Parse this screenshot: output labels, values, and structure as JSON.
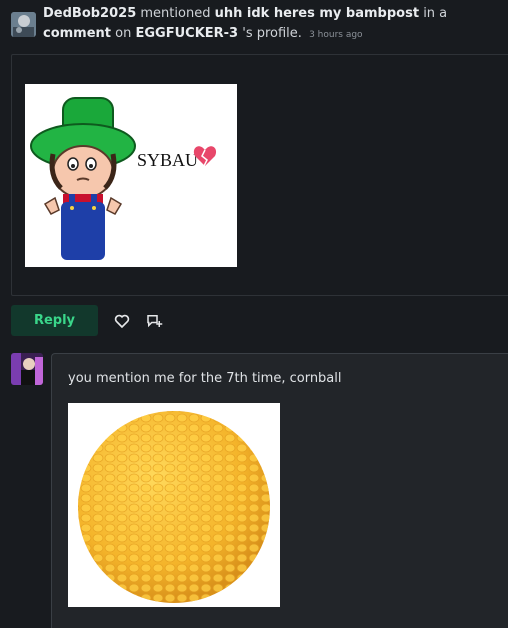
{
  "notification": {
    "actor": "DedBob2025",
    "verb": "mentioned",
    "post_title": "uhh idk heres my bambpost",
    "in_a": "in a",
    "comment_word": "comment",
    "on": "on",
    "profile_owner": "EGGFUCKER-3",
    "profile_suffix": "'s profile.",
    "timestamp": "3 hours ago"
  },
  "post": {
    "image_caption": "SYBAU"
  },
  "actions": {
    "reply_label": "Reply",
    "like_icon": "heart-icon",
    "add_icon": "add-comment-icon"
  },
  "reply": {
    "text": "you mention me for the 7th time, cornball"
  },
  "colors": {
    "background": "#181b1f",
    "card": "#222529",
    "reply_button_bg": "#12382c",
    "reply_button_text": "#3ad68a"
  }
}
